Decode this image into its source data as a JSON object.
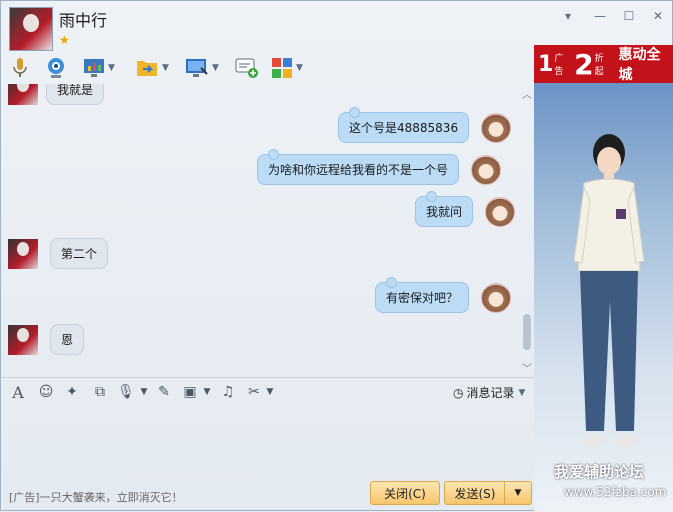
{
  "window": {
    "contact_name": "雨中行",
    "controls": [
      "▾",
      "—",
      "☐",
      "✕"
    ]
  },
  "toolbar": {
    "icons": [
      "microphone-icon",
      "video-camera-icon",
      "screen-share-icon",
      "file-transfer-icon",
      "remote-desktop-icon",
      "create-discussion-icon",
      "apps-icon"
    ]
  },
  "chat": {
    "partial_top_text": "我就是",
    "messages": [
      {
        "from": "me",
        "text": "这个号是48885836"
      },
      {
        "from": "me",
        "text": "为啥和你远程给我看的不是一个号"
      },
      {
        "from": "me",
        "text": "我就问"
      },
      {
        "from": "them",
        "text": "第二个"
      },
      {
        "from": "me",
        "text": "有密保对吧？"
      },
      {
        "from": "them",
        "text": "恩"
      }
    ]
  },
  "input_toolbar": {
    "tools": [
      "font-icon",
      "emoji-icon",
      "magic-icon",
      "shake-icon",
      "voice-icon",
      "handwriting-icon",
      "image-icon",
      "music-icon",
      "scissors-icon"
    ],
    "history_label": "消息记录"
  },
  "footer": {
    "ad_text": "[广告]一只大蟹袭来，立即消灭它！",
    "close_label": "关闭(C)",
    "send_label": "发送(S)"
  },
  "side_ad": {
    "banner_one": "1",
    "banner_small": "广告",
    "banner_two": "2",
    "banner_fold": "折起",
    "banner_text": "惠动全城",
    "forum_name": "我爱辅助论坛",
    "forum_url": "www.52fzba.com"
  },
  "colors": {
    "bubble_me": "#bcdcf6",
    "bubble_them": "#e0e6ee",
    "button": "#f6c66d",
    "banner": "#c4121a"
  }
}
